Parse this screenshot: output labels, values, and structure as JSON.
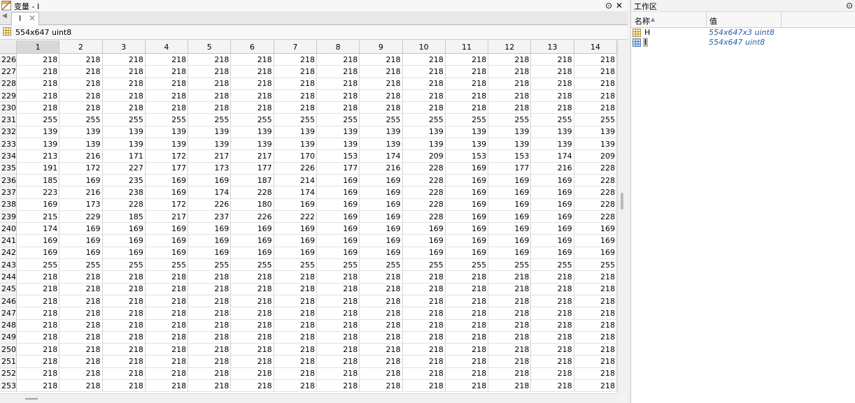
{
  "variable_editor": {
    "window_title": "变量 - I",
    "tab_label": "I",
    "info": "554x647 uint8",
    "columns": [
      "1",
      "2",
      "3",
      "4",
      "5",
      "6",
      "7",
      "8",
      "9",
      "10",
      "11",
      "12",
      "13",
      "14"
    ],
    "rows": [
      {
        "index": "226",
        "cells": [
          "218",
          "218",
          "218",
          "218",
          "218",
          "218",
          "218",
          "218",
          "218",
          "218",
          "218",
          "218",
          "218",
          "218"
        ]
      },
      {
        "index": "227",
        "cells": [
          "218",
          "218",
          "218",
          "218",
          "218",
          "218",
          "218",
          "218",
          "218",
          "218",
          "218",
          "218",
          "218",
          "218"
        ]
      },
      {
        "index": "228",
        "cells": [
          "218",
          "218",
          "218",
          "218",
          "218",
          "218",
          "218",
          "218",
          "218",
          "218",
          "218",
          "218",
          "218",
          "218"
        ]
      },
      {
        "index": "229",
        "cells": [
          "218",
          "218",
          "218",
          "218",
          "218",
          "218",
          "218",
          "218",
          "218",
          "218",
          "218",
          "218",
          "218",
          "218"
        ]
      },
      {
        "index": "230",
        "cells": [
          "218",
          "218",
          "218",
          "218",
          "218",
          "218",
          "218",
          "218",
          "218",
          "218",
          "218",
          "218",
          "218",
          "218"
        ]
      },
      {
        "index": "231",
        "cells": [
          "255",
          "255",
          "255",
          "255",
          "255",
          "255",
          "255",
          "255",
          "255",
          "255",
          "255",
          "255",
          "255",
          "255"
        ]
      },
      {
        "index": "232",
        "cells": [
          "139",
          "139",
          "139",
          "139",
          "139",
          "139",
          "139",
          "139",
          "139",
          "139",
          "139",
          "139",
          "139",
          "139"
        ]
      },
      {
        "index": "233",
        "cells": [
          "139",
          "139",
          "139",
          "139",
          "139",
          "139",
          "139",
          "139",
          "139",
          "139",
          "139",
          "139",
          "139",
          "139"
        ]
      },
      {
        "index": "234",
        "cells": [
          "213",
          "216",
          "171",
          "172",
          "217",
          "217",
          "170",
          "153",
          "174",
          "209",
          "153",
          "153",
          "174",
          "209"
        ]
      },
      {
        "index": "235",
        "cells": [
          "191",
          "172",
          "227",
          "177",
          "173",
          "177",
          "226",
          "177",
          "216",
          "228",
          "169",
          "177",
          "216",
          "228"
        ]
      },
      {
        "index": "236",
        "cells": [
          "185",
          "169",
          "235",
          "169",
          "169",
          "187",
          "214",
          "169",
          "169",
          "228",
          "169",
          "169",
          "169",
          "228"
        ]
      },
      {
        "index": "237",
        "cells": [
          "223",
          "216",
          "238",
          "169",
          "174",
          "228",
          "174",
          "169",
          "169",
          "228",
          "169",
          "169",
          "169",
          "228"
        ]
      },
      {
        "index": "238",
        "cells": [
          "169",
          "173",
          "228",
          "172",
          "226",
          "180",
          "169",
          "169",
          "169",
          "228",
          "169",
          "169",
          "169",
          "228"
        ]
      },
      {
        "index": "239",
        "cells": [
          "215",
          "229",
          "185",
          "217",
          "237",
          "226",
          "222",
          "169",
          "169",
          "228",
          "169",
          "169",
          "169",
          "228"
        ]
      },
      {
        "index": "240",
        "cells": [
          "174",
          "169",
          "169",
          "169",
          "169",
          "169",
          "169",
          "169",
          "169",
          "169",
          "169",
          "169",
          "169",
          "169"
        ]
      },
      {
        "index": "241",
        "cells": [
          "169",
          "169",
          "169",
          "169",
          "169",
          "169",
          "169",
          "169",
          "169",
          "169",
          "169",
          "169",
          "169",
          "169"
        ]
      },
      {
        "index": "242",
        "cells": [
          "169",
          "169",
          "169",
          "169",
          "169",
          "169",
          "169",
          "169",
          "169",
          "169",
          "169",
          "169",
          "169",
          "169"
        ]
      },
      {
        "index": "243",
        "cells": [
          "255",
          "255",
          "255",
          "255",
          "255",
          "255",
          "255",
          "255",
          "255",
          "255",
          "255",
          "255",
          "255",
          "255"
        ]
      },
      {
        "index": "244",
        "cells": [
          "218",
          "218",
          "218",
          "218",
          "218",
          "218",
          "218",
          "218",
          "218",
          "218",
          "218",
          "218",
          "218",
          "218"
        ]
      },
      {
        "index": "245",
        "cells": [
          "218",
          "218",
          "218",
          "218",
          "218",
          "218",
          "218",
          "218",
          "218",
          "218",
          "218",
          "218",
          "218",
          "218"
        ]
      },
      {
        "index": "246",
        "cells": [
          "218",
          "218",
          "218",
          "218",
          "218",
          "218",
          "218",
          "218",
          "218",
          "218",
          "218",
          "218",
          "218",
          "218"
        ]
      },
      {
        "index": "247",
        "cells": [
          "218",
          "218",
          "218",
          "218",
          "218",
          "218",
          "218",
          "218",
          "218",
          "218",
          "218",
          "218",
          "218",
          "218"
        ]
      },
      {
        "index": "248",
        "cells": [
          "218",
          "218",
          "218",
          "218",
          "218",
          "218",
          "218",
          "218",
          "218",
          "218",
          "218",
          "218",
          "218",
          "218"
        ]
      },
      {
        "index": "249",
        "cells": [
          "218",
          "218",
          "218",
          "218",
          "218",
          "218",
          "218",
          "218",
          "218",
          "218",
          "218",
          "218",
          "218",
          "218"
        ]
      },
      {
        "index": "250",
        "cells": [
          "218",
          "218",
          "218",
          "218",
          "218",
          "218",
          "218",
          "218",
          "218",
          "218",
          "218",
          "218",
          "218",
          "218"
        ]
      },
      {
        "index": "251",
        "cells": [
          "218",
          "218",
          "218",
          "218",
          "218",
          "218",
          "218",
          "218",
          "218",
          "218",
          "218",
          "218",
          "218",
          "218"
        ]
      },
      {
        "index": "252",
        "cells": [
          "218",
          "218",
          "218",
          "218",
          "218",
          "218",
          "218",
          "218",
          "218",
          "218",
          "218",
          "218",
          "218",
          "218"
        ]
      },
      {
        "index": "253",
        "cells": [
          "218",
          "218",
          "218",
          "218",
          "218",
          "218",
          "218",
          "218",
          "218",
          "218",
          "218",
          "218",
          "218",
          "218"
        ]
      }
    ]
  },
  "workspace": {
    "title": "工作区",
    "col_name": "名称",
    "col_value": "值",
    "items": [
      {
        "name": "H",
        "value": "554x647x3 uint8",
        "icon": "table-icon"
      },
      {
        "name": "I",
        "value": "554x647 uint8",
        "icon": "matrix-icon"
      }
    ]
  },
  "icons": {
    "titlebar_icon": "variable-editor-icon",
    "minimize": "▾",
    "close": "✕",
    "tab_close": "✕",
    "tab_arrow": "◀",
    "ws_menu": "⊙"
  },
  "colors": {
    "value_text": "#2b5fa5",
    "selected_name_bg": "#b8b8b8",
    "selected_col_header": "#d8d8d8"
  }
}
